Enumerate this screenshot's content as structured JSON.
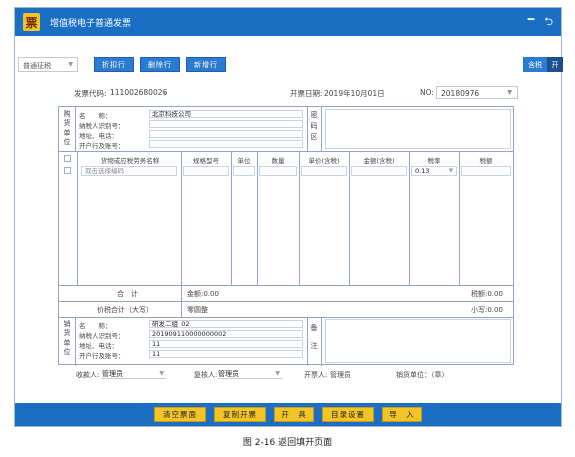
{
  "window": {
    "logo_char": "票",
    "title": "增值税电子普通发票",
    "minimize": "━",
    "back": "⮌"
  },
  "toolbar": {
    "invoice_type": "普通征税",
    "btn_discount": "折扣行",
    "btn_delete": "删除行",
    "btn_add": "新增行",
    "tax_incl": "含税",
    "tax_on": "开"
  },
  "meta": {
    "code_label": "发票代码:",
    "code_value": "111002680026",
    "date_label": "开票日期:",
    "date_value": "2019年10月01日",
    "no_label": "NO:",
    "no_value": "20180976"
  },
  "buyer": {
    "side": [
      "购",
      "货",
      "单",
      "位"
    ],
    "name_label": "名　　称：",
    "name_value": "北京科技公司",
    "taxid_label": "纳税人识别号：",
    "taxid_value": "",
    "addr_label": "地址、电话：",
    "addr_value": "",
    "bank_label": "开户行及账号：",
    "bank_value": ""
  },
  "mima": [
    "密",
    "码",
    "区"
  ],
  "items_header": {
    "name": "货物或应税劳务名称",
    "spec": "规格型号",
    "unit": "单位",
    "qty": "数量",
    "price": "单价(含税)",
    "amount": "金额(含税)",
    "rate": "税率",
    "tax": "税额"
  },
  "items_row": {
    "name_placeholder": "双击选择编码",
    "rate": "0.13"
  },
  "totals": {
    "sum_label": "合　计",
    "amount": "金额:0.00",
    "tax": "税额:0.00",
    "total_label": "价税合计（大写）",
    "total_words": "零圆整",
    "total_small": "小写:0.00"
  },
  "seller": {
    "side": [
      "销",
      "货",
      "单",
      "位"
    ],
    "name_label": "名　　称：",
    "name_value": "研发二组_02",
    "taxid_label": "纳税人识别号：",
    "taxid_value": "201909110000000002",
    "addr_label": "地址、电话：",
    "addr_value": "11",
    "bank_label": "开户行及账号：",
    "bank_value": "11"
  },
  "remark": [
    "备",
    "注"
  ],
  "persons": {
    "payee_label": "收款人:",
    "payee_value": "管理员",
    "reviewer_label": "复核人:",
    "reviewer_value": "管理员",
    "drawer_label": "开票人:",
    "drawer_value": "管理员",
    "seal": "销货单位：（章）"
  },
  "bottom": {
    "clear": "清空票面",
    "copy": "复制开票",
    "issue": "开　具",
    "catalog": "目录设置",
    "import": "导　入"
  },
  "caption": "图 2-16 返回填开页面",
  "colors": {
    "title_bar": "#1a6fc4",
    "button_blue": "#2b7bd0",
    "button_yellow": "#f3c428",
    "border": "#8fa6c8"
  }
}
